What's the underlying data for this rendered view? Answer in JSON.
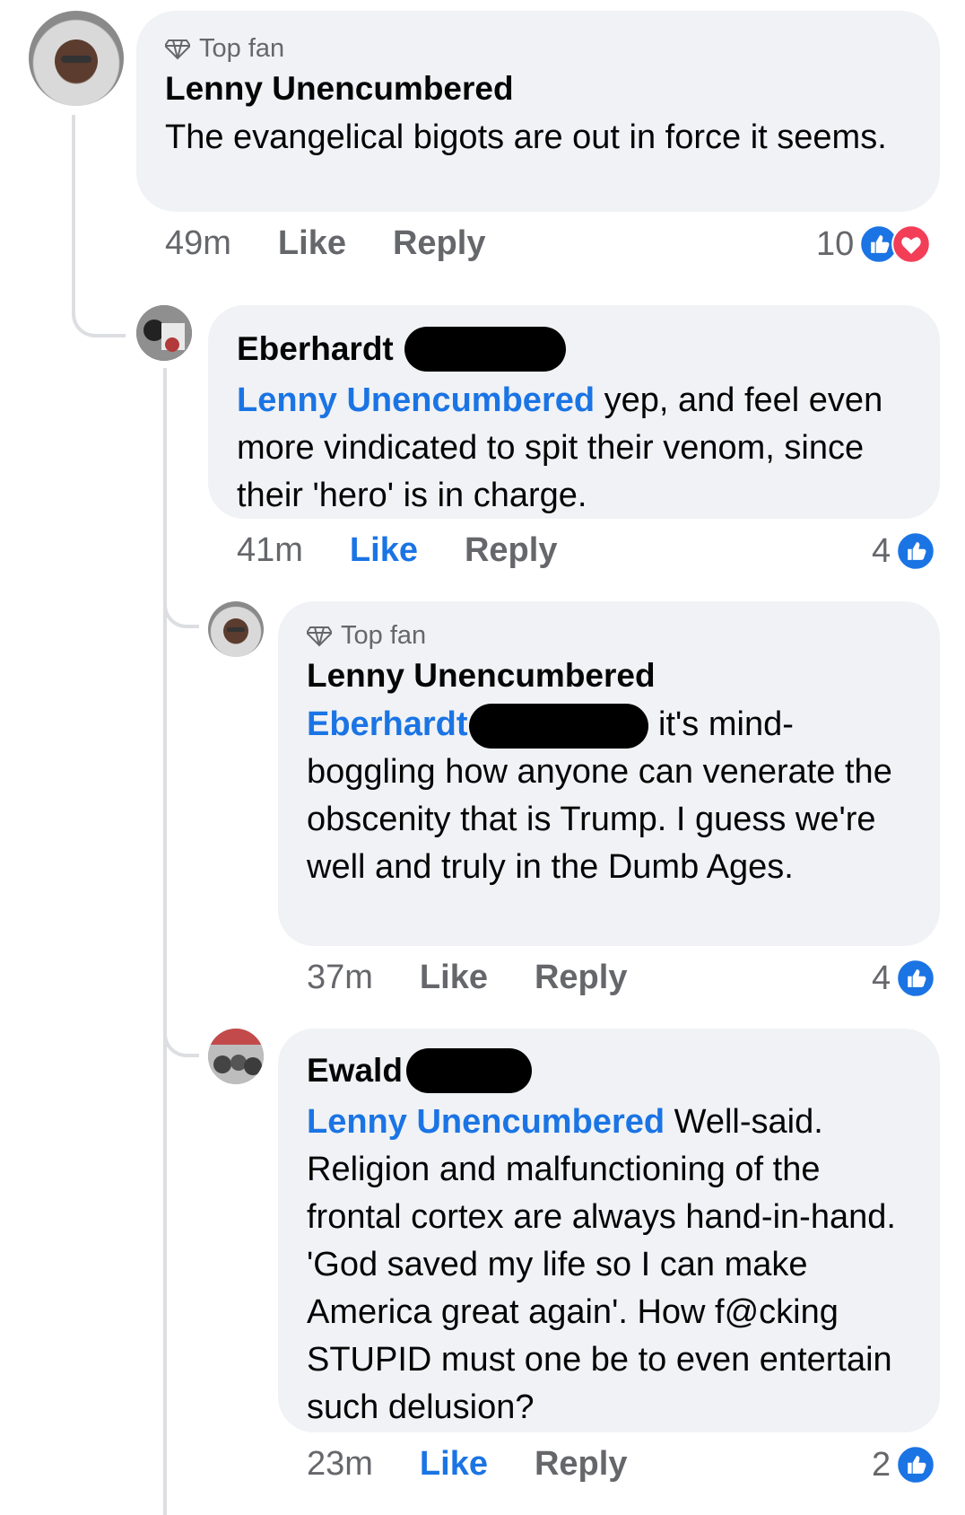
{
  "comments": [
    {
      "badge": "Top fan",
      "author": "Lenny Unencumbered",
      "text": "The evangelical bigots are out in force it seems.",
      "time": "49m",
      "like": "Like",
      "reply": "Reply",
      "reaction_count": "10",
      "reactions": [
        "like-icon",
        "love-icon"
      ]
    },
    {
      "author": "Eberhardt",
      "mention": "Lenny Unencumbered",
      "text": " yep, and feel even more vindicated to spit their venom, since their 'hero' is in charge.",
      "time": "41m",
      "like": "Like",
      "reply": "Reply",
      "liked": true,
      "reaction_count": "4",
      "reactions": [
        "like-icon"
      ]
    },
    {
      "badge": "Top fan",
      "author": "Lenny Unencumbered",
      "mention": "Eberhardt",
      "text": " it's mind-boggling how anyone can venerate the obscenity that is Trump. I guess we're well and truly in the Dumb Ages.",
      "time": "37m",
      "like": "Like",
      "reply": "Reply",
      "reaction_count": "4",
      "reactions": [
        "like-icon"
      ]
    },
    {
      "author": "Ewald",
      "mention": "Lenny Unencumbered",
      "text": " Well-said. Religion and malfunctioning of the frontal cortex are always hand-in-hand. 'God saved my life so I can make America great again'. How f@cking STUPID must one be to even entertain such delusion?",
      "time": "23m",
      "like": "Like",
      "reply": "Reply",
      "liked": true,
      "reaction_count": "2",
      "reactions": [
        "like-icon"
      ]
    }
  ],
  "colors": {
    "link": "#1b74e4",
    "bubble": "#f0f2f5",
    "meta": "#65676b",
    "like_icon": "#1b74e4",
    "love_icon": "#f33e58"
  }
}
